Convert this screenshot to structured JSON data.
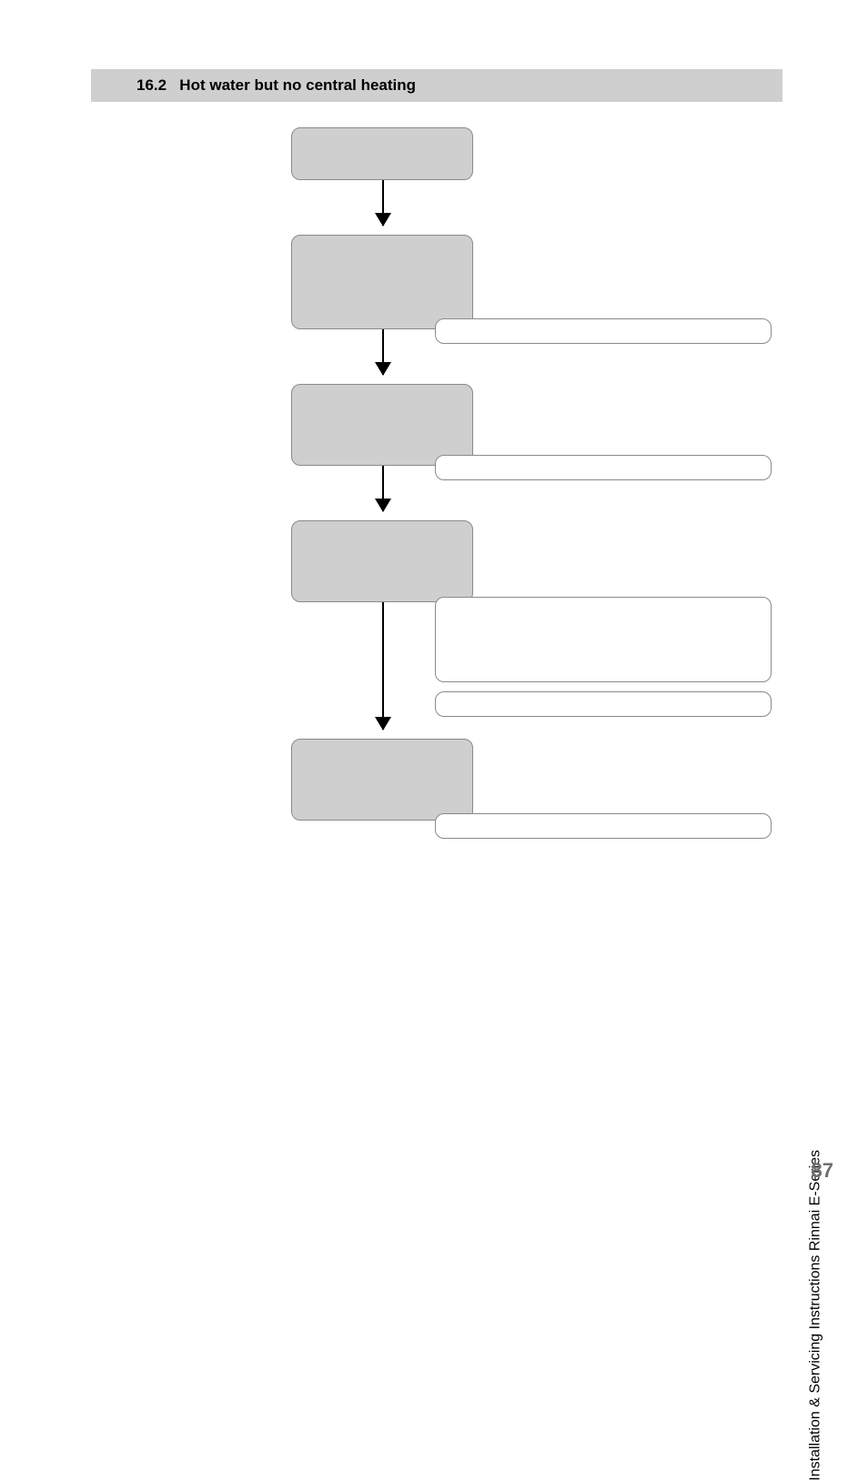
{
  "header": {
    "number": "16.2",
    "title": "Hot water but no central heating"
  },
  "boxes": {
    "b1": "",
    "b2": "",
    "b3": "",
    "b4": "",
    "b5": ""
  },
  "white": {
    "w1": "",
    "w2": "",
    "w3": "",
    "w4": "",
    "w5": ""
  },
  "footer": {
    "sidetext": "Installation & Servicing Instructions Rinnai E-Series",
    "page": "87"
  }
}
